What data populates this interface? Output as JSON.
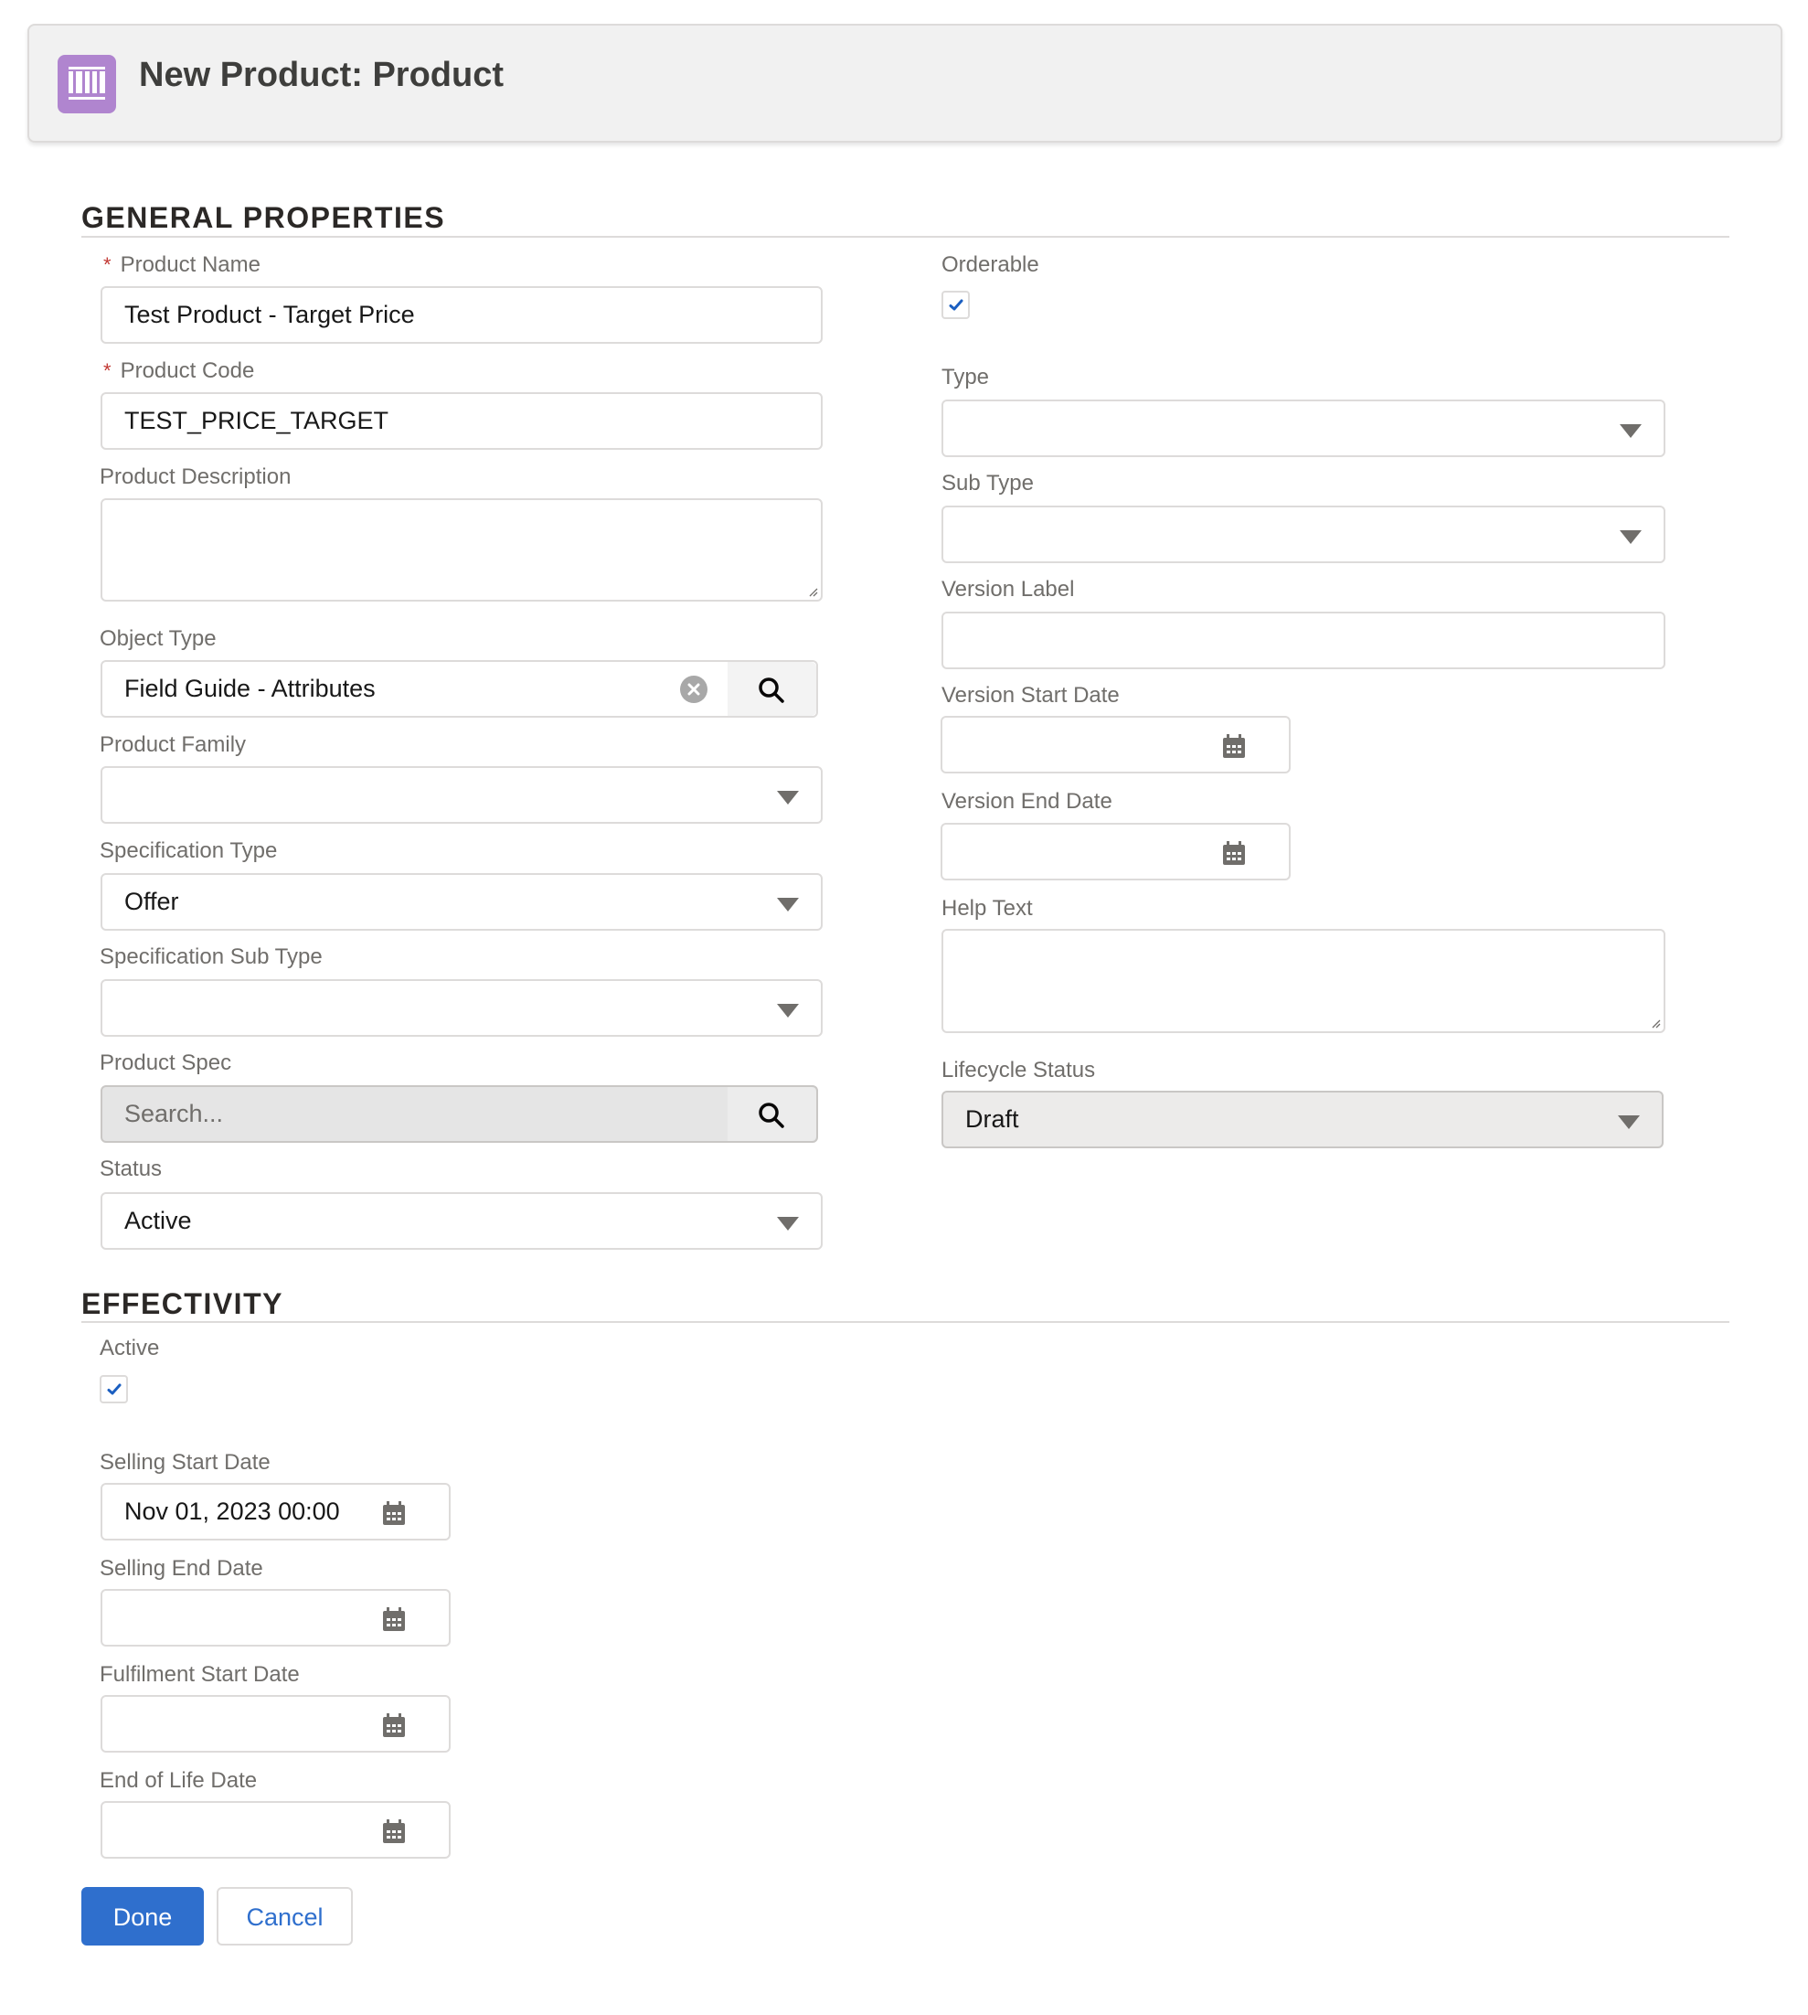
{
  "header": {
    "title": "New Product: Product",
    "icon": "product-icon",
    "icon_color": "#b085cf"
  },
  "sections": {
    "general": {
      "title": "GENERAL PROPERTIES"
    },
    "effectivity": {
      "title": "EFFECTIVITY"
    }
  },
  "general": {
    "product_name": {
      "label": "Product Name",
      "required": true,
      "value": "Test Product - Target Price"
    },
    "product_code": {
      "label": "Product Code",
      "required": true,
      "value": "TEST_PRICE_TARGET"
    },
    "product_description": {
      "label": "Product Description",
      "value": ""
    },
    "object_type": {
      "label": "Object Type",
      "value": "Field Guide - Attributes",
      "clear_icon": "clear-icon",
      "search_icon": "search-icon"
    },
    "product_family": {
      "label": "Product Family",
      "value": ""
    },
    "specification_type": {
      "label": "Specification Type",
      "value": "Offer"
    },
    "specification_sub_type": {
      "label": "Specification Sub Type",
      "value": ""
    },
    "product_spec": {
      "label": "Product Spec",
      "placeholder": "Search...",
      "search_icon": "search-icon"
    },
    "status": {
      "label": "Status",
      "value": "Active"
    },
    "orderable": {
      "label": "Orderable",
      "checked": true
    },
    "type": {
      "label": "Type",
      "value": ""
    },
    "sub_type": {
      "label": "Sub Type",
      "value": ""
    },
    "version_label": {
      "label": "Version Label",
      "value": ""
    },
    "version_start_date": {
      "label": "Version Start Date",
      "value": ""
    },
    "version_end_date": {
      "label": "Version End Date",
      "value": ""
    },
    "help_text": {
      "label": "Help Text",
      "value": ""
    },
    "lifecycle_status": {
      "label": "Lifecycle Status",
      "value": "Draft"
    }
  },
  "effectivity": {
    "active": {
      "label": "Active",
      "checked": true
    },
    "selling_start_date": {
      "label": "Selling Start Date",
      "value": "Nov 01, 2023 00:00"
    },
    "selling_end_date": {
      "label": "Selling End Date",
      "value": ""
    },
    "fulfilment_start_date": {
      "label": "Fulfilment Start Date",
      "value": ""
    },
    "end_of_life_date": {
      "label": "End of Life Date",
      "value": ""
    }
  },
  "actions": {
    "done_label": "Done",
    "cancel_label": "Cancel"
  },
  "colors": {
    "brand_blue": "#2f6fcd",
    "required": "#c23934"
  }
}
